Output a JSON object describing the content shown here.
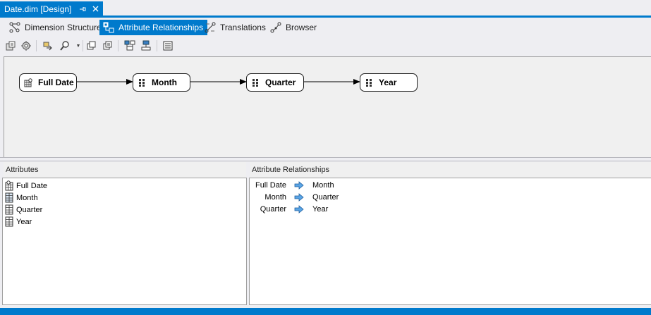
{
  "document_tab": {
    "title": "Date.dim [Design]",
    "pin_icon": "pin-icon",
    "close_icon": "close-icon"
  },
  "designer_tabs": [
    {
      "label": "Dimension Structure",
      "icon": "dimension-structure-icon",
      "active": false
    },
    {
      "label": "Attribute Relationships",
      "icon": "attribute-relationships-icon",
      "active": true
    },
    {
      "label": "Translations",
      "icon": "translations-icon",
      "active": false
    },
    {
      "label": "Browser",
      "icon": "browser-icon",
      "active": false
    }
  ],
  "toolbar": {
    "buttons": [
      "process-icon",
      "reconnect-icon",
      "new-relationship-icon",
      "zoom-icon",
      "zoom-dropdown-icon",
      "copy-icon",
      "paste-icon",
      "expand-icon",
      "collapse-icon",
      "properties-icon"
    ]
  },
  "diagram": {
    "nodes": [
      {
        "label": "Full Date",
        "icon": "key-attribute-icon"
      },
      {
        "label": "Month",
        "icon": "attribute-icon"
      },
      {
        "label": "Quarter",
        "icon": "attribute-icon"
      },
      {
        "label": "Year",
        "icon": "attribute-icon"
      }
    ]
  },
  "attributes_pane": {
    "header": "Attributes",
    "items": [
      {
        "label": "Full Date",
        "icon": "key-attribute-icon"
      },
      {
        "label": "Month",
        "icon": "attribute-icon"
      },
      {
        "label": "Quarter",
        "icon": "attribute-icon"
      },
      {
        "label": "Year",
        "icon": "attribute-icon"
      }
    ]
  },
  "relationships_pane": {
    "header": "Attribute Relationships",
    "rows": [
      {
        "source": "Full Date",
        "target": "Month"
      },
      {
        "source": "Month",
        "target": "Quarter"
      },
      {
        "source": "Quarter",
        "target": "Year"
      }
    ]
  },
  "colors": {
    "accent": "#007acc",
    "chrome": "#eeeef2",
    "diagram_bg": "#f0f0f0",
    "pane_bg": "#ffffff"
  }
}
